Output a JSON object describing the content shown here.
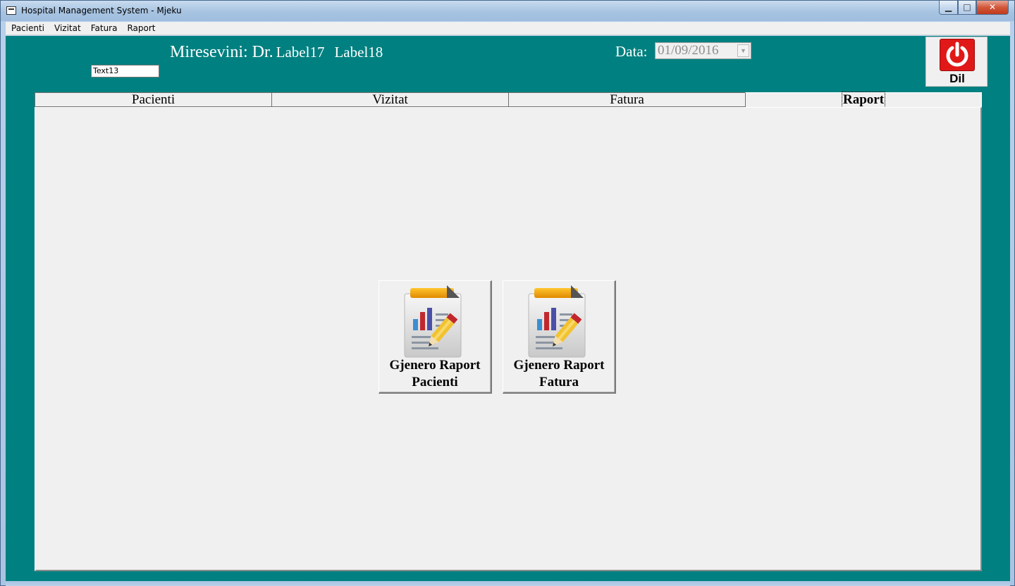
{
  "window": {
    "title": "Hospital Management System - Mjeku",
    "controls": {
      "minimize": "▁",
      "maximize": "□",
      "close": "✕"
    }
  },
  "menu": [
    "Pacienti",
    "Vizitat",
    "Fatura",
    "Raport"
  ],
  "header": {
    "welcome_prefix": "Miresevini: Dr.",
    "label17": "Label17",
    "label18": "Label18",
    "text13": "Text13",
    "date_label": "Data:",
    "date_value": "01/09/2016",
    "exit_label": "Dil"
  },
  "tabs": [
    {
      "label": "Pacienti",
      "active": false
    },
    {
      "label": "Vizitat",
      "active": false
    },
    {
      "label": "Fatura",
      "active": false
    },
    {
      "label": "Raport",
      "active": true
    }
  ],
  "report_buttons": [
    {
      "line1": "Gjenero Raport",
      "line2": "Pacienti",
      "icon": "report-chart-pencil-icon"
    },
    {
      "line1": "Gjenero Raport",
      "line2": "Fatura",
      "icon": "report-chart-pencil-icon"
    }
  ],
  "colors": {
    "form_background": "#008080",
    "panel_background": "#f0f0f0",
    "exit_red": "#e01818"
  }
}
